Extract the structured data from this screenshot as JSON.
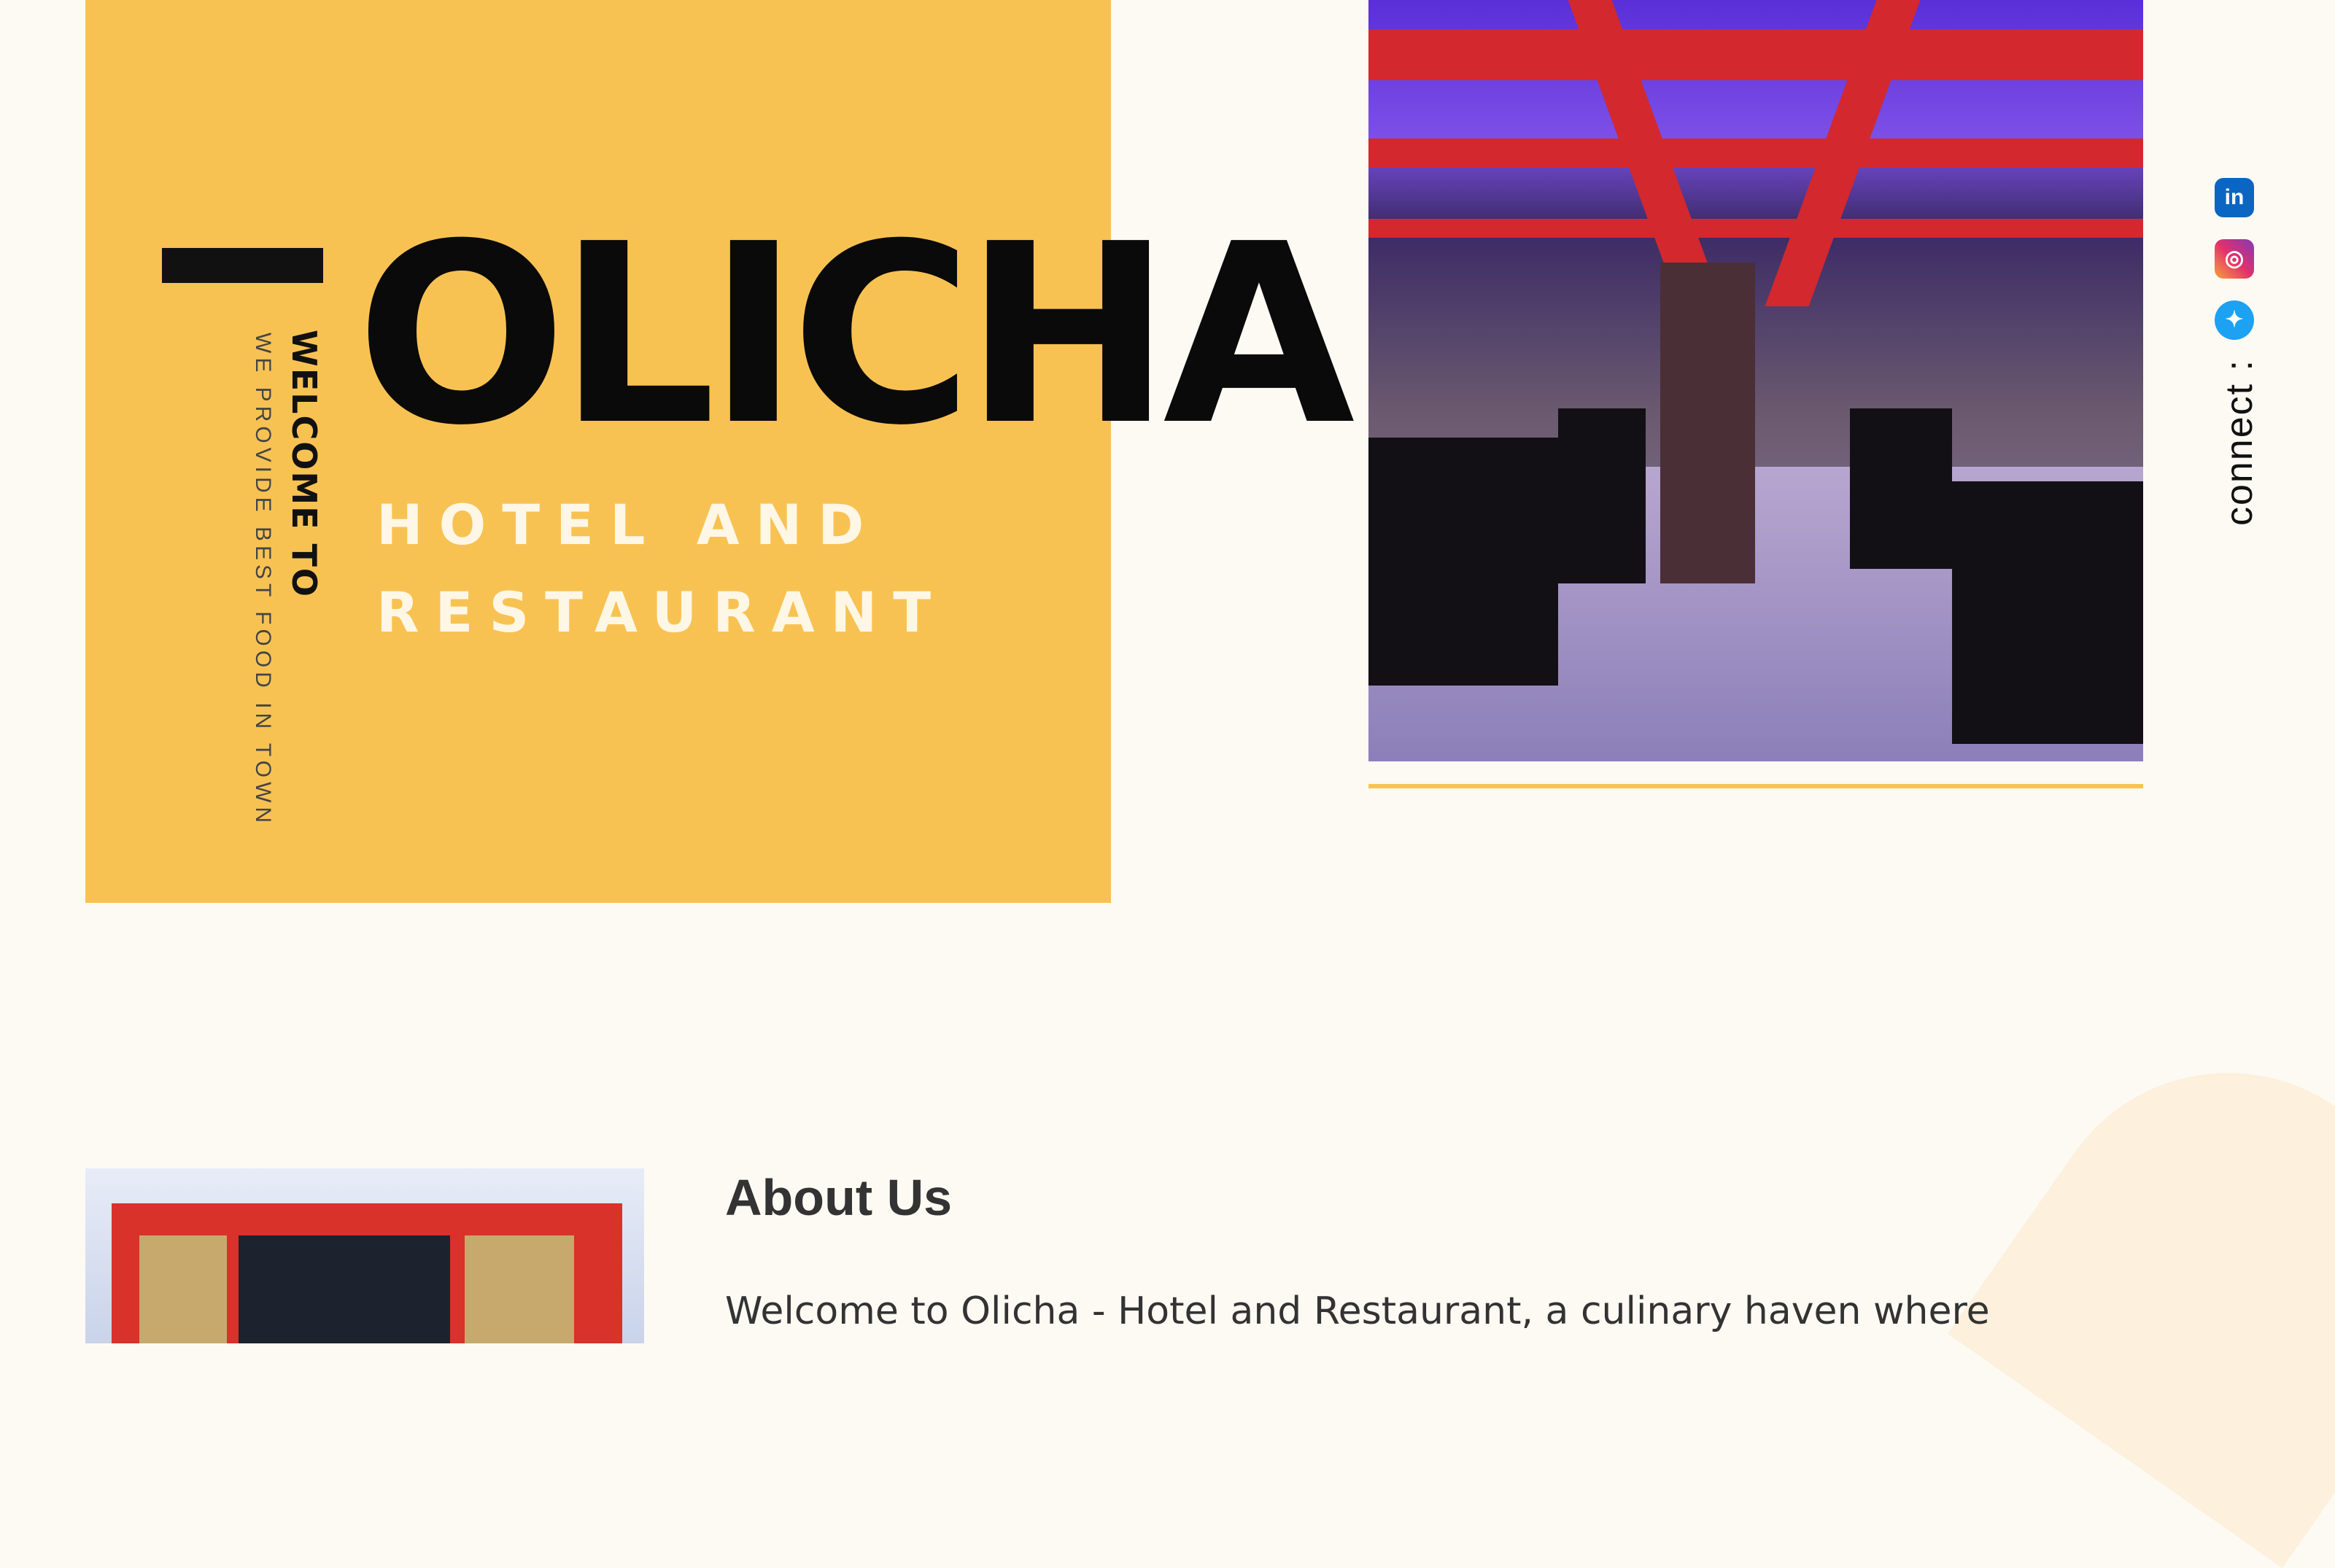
{
  "hero": {
    "brand": "OLICHA",
    "welcome": "WELCOME TO",
    "tagline": "WE PROVIDE BEST FOOD IN TOWN",
    "subtitle_line1": "HOTEL AND",
    "subtitle_line2": "RESTAURANT"
  },
  "social": {
    "connect_label": "connect :",
    "icons": [
      "linkedin-icon",
      "instagram-icon",
      "twitter-icon"
    ]
  },
  "about": {
    "title": "About Us",
    "text": "Welcome to Olicha - Hotel and Restaurant, a culinary haven where"
  },
  "colors": {
    "accent": "#f8c253",
    "background": "#fdfaf4",
    "text": "#111111"
  }
}
